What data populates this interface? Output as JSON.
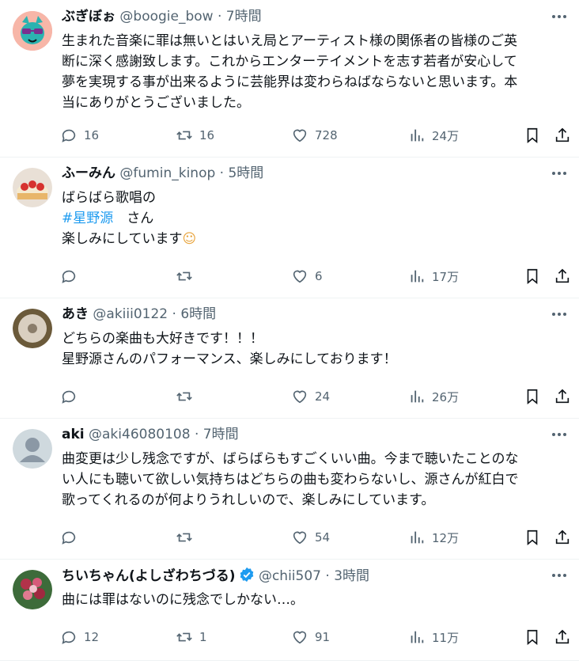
{
  "tweets": [
    {
      "name": "ぶぎぼぉ",
      "handle": "@boogie_bow",
      "time": "7時間",
      "lines": [
        "生まれた音楽に罪は無いとはいえ局とアーティスト様の関係者の皆様のご英",
        "断に深く感謝致します。これからエンターテイメントを志す若者が安心して",
        "夢を実現する事が出来るように芸能界は変わらねばならないと思います。本",
        "当にありがとうございました。"
      ],
      "replies": "16",
      "retweets": "16",
      "likes": "728",
      "views": "24万"
    },
    {
      "name": "ふーみん",
      "handle": "@fumin_kinop",
      "time": "5時間",
      "lines": [
        "ばらばら歌唱の",
        "#星野源",
        "楽しみにしています"
      ],
      "line2_suffix": "　さん",
      "emoji": "☺",
      "replies": "",
      "retweets": "",
      "likes": "6",
      "views": "17万"
    },
    {
      "name": "あき",
      "handle": "@akiii0122",
      "time": "6時間",
      "lines": [
        "どちらの楽曲も大好きです！！！",
        "星野源さんのパフォーマンス、楽しみにしております！"
      ],
      "replies": "",
      "retweets": "",
      "likes": "24",
      "views": "26万"
    },
    {
      "name": "aki",
      "handle": "@aki46080108",
      "time": "7時間",
      "lines": [
        "曲変更は少し残念ですが、ばらばらもすごくいい曲。今まで聴いたことのな",
        "い人にも聴いて欲しい気持ちはどちらの曲も変わらないし、源さんが紅白で",
        "歌ってくれるのが何よりうれしいので、楽しみにしています。"
      ],
      "replies": "",
      "retweets": "",
      "likes": "54",
      "views": "12万"
    },
    {
      "name": "ちいちゃん(よしざわちづる)",
      "handle": "@chii507",
      "time": "3時間",
      "lines": [
        "曲には罪はないのに残念でしかない…。"
      ],
      "replies": "12",
      "retweets": "1",
      "likes": "91",
      "views": "11万"
    }
  ],
  "separator": "·",
  "colors": {
    "text": "#0f1419",
    "secondary": "#536471",
    "link": "#1d9bf0",
    "verified": "#1d9bf0",
    "divider": "#eff3f4"
  }
}
